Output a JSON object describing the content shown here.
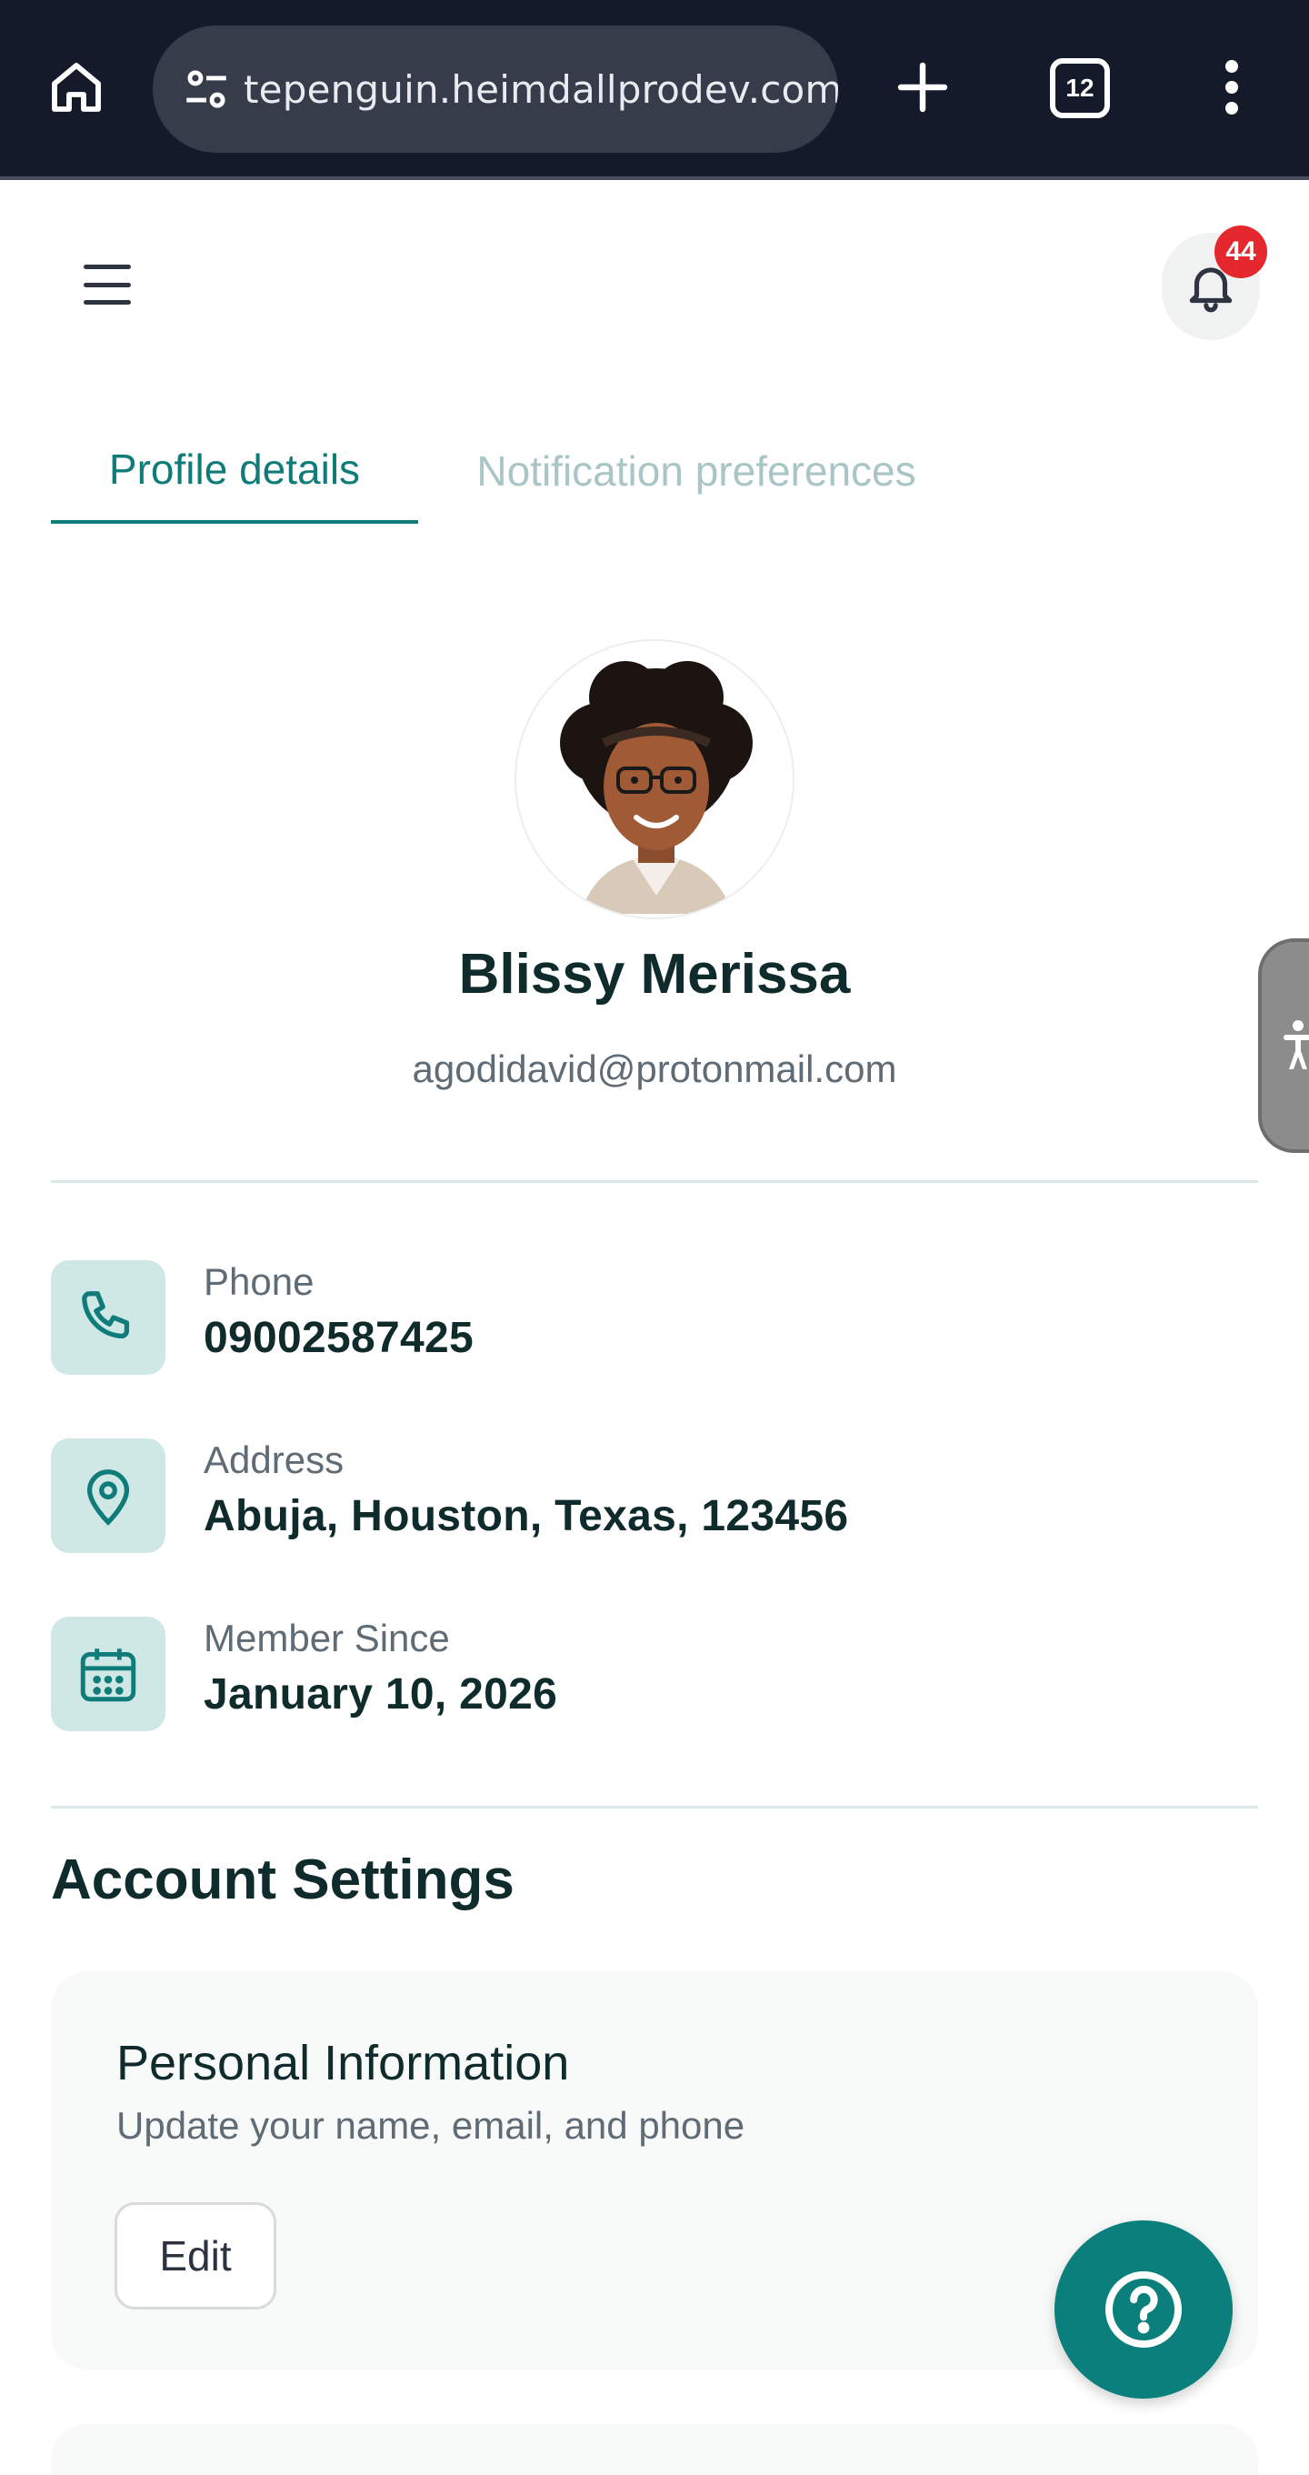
{
  "browser": {
    "url": "tepenguin.heimdallprodev.com",
    "tab_count": "12",
    "icons": [
      "home-icon",
      "site-settings-icon",
      "plus-icon",
      "tabs-icon",
      "more-vertical-icon"
    ]
  },
  "header": {
    "notification_count": "44",
    "icons": [
      "menu-icon",
      "bell-icon"
    ]
  },
  "tabs": [
    {
      "label": "Profile details",
      "active": true
    },
    {
      "label": "Notification preferences",
      "active": false
    }
  ],
  "profile": {
    "name": "Blissy Merissa",
    "email": "agodidavid@protonmail.com"
  },
  "info": [
    {
      "label": "Phone",
      "value": "09002587425",
      "icon": "phone-icon"
    },
    {
      "label": "Address",
      "value": "Abuja, Houston, Texas, 123456",
      "icon": "map-pin-icon"
    },
    {
      "label": "Member Since",
      "value": "January 10, 2026",
      "icon": "calendar-icon"
    }
  ],
  "account_settings": {
    "title": "Account Settings",
    "personal_info": {
      "title": "Personal Information",
      "subtitle": "Update your name, email, and phone",
      "edit_label": "Edit"
    }
  },
  "colors": {
    "accent": "#0f7c7a",
    "badge": "#e5282d",
    "icon_tile": "#cfe7e5",
    "browser_bg": "#141a2a"
  }
}
